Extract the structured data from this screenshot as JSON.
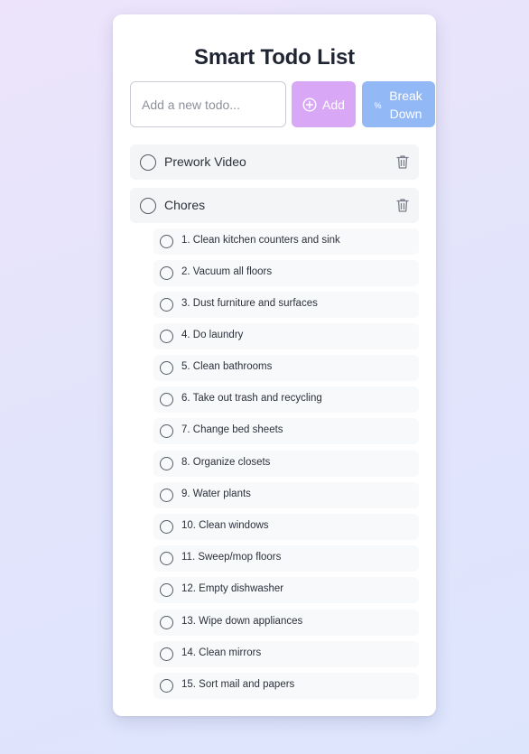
{
  "app": {
    "title": "Smart Todo List"
  },
  "input": {
    "placeholder": "Add a new todo..."
  },
  "buttons": {
    "add_label": "Add",
    "break_down_label": "Break Down",
    "break_icon": "%"
  },
  "todos": [
    {
      "label": "Prework Video"
    },
    {
      "label": "Chores"
    }
  ],
  "subtasks": [
    {
      "label": "1. Clean kitchen counters and sink"
    },
    {
      "label": "2. Vacuum all floors"
    },
    {
      "label": "3. Dust furniture and surfaces"
    },
    {
      "label": "4. Do laundry"
    },
    {
      "label": "5. Clean bathrooms"
    },
    {
      "label": "6. Take out trash and recycling"
    },
    {
      "label": "7. Change bed sheets"
    },
    {
      "label": "8. Organize closets"
    },
    {
      "label": "9. Water plants"
    },
    {
      "label": "10. Clean windows"
    },
    {
      "label": "11. Sweep/mop floors"
    },
    {
      "label": "12. Empty dishwasher"
    },
    {
      "label": "13. Wipe down appliances"
    },
    {
      "label": "14. Clean mirrors"
    },
    {
      "label": "15. Sort mail and papers"
    }
  ],
  "colors": {
    "add_button": "#d8a8f6",
    "break_button": "#93b8f6",
    "card": "#ffffff"
  },
  "icons": {
    "add": "plus-circle-icon",
    "break_down": "percent-icon",
    "delete": "trash-icon",
    "checkbox": "circle-icon"
  }
}
